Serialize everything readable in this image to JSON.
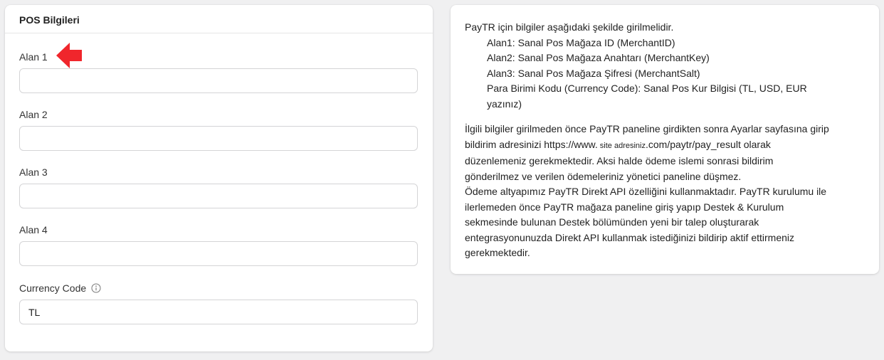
{
  "pos_card": {
    "title": "POS Bilgileri",
    "fields": [
      {
        "label": "Alan 1",
        "value": ""
      },
      {
        "label": "Alan 2",
        "value": ""
      },
      {
        "label": "Alan 3",
        "value": ""
      },
      {
        "label": "Alan 4",
        "value": ""
      },
      {
        "label": "Currency Code",
        "value": "TL"
      }
    ],
    "info_icon": "info-circle-icon",
    "annotation_arrow": "red-arrow-icon",
    "annotation_color": "#f0262c"
  },
  "info_card": {
    "intro": "PayTR için bilgiler aşağıdaki şekilde girilmelidir.",
    "items": [
      "Alan1: Sanal Pos Mağaza ID (MerchantID)",
      "Alan2: Sanal Pos Mağaza Anahtarı (MerchantKey)",
      "Alan3: Sanal Pos Mağaza Şifresi (MerchantSalt)",
      "Para Birimi Kodu (Currency Code): Sanal Pos Kur Bilgisi (TL, USD, EUR",
      "yazınız)"
    ],
    "para1_part1": "İlgili bilgiler girilmeden önce PayTR paneline girdikten sonra Ayarlar sayfasına girip",
    "para1_part2a": "bildirim adresinizi https://www.",
    "para1_part2_small": " site adresiniz",
    "para1_part2b": ".com/paytr/pay_result olarak",
    "para1_part3": "düzenlemeniz gerekmektedir. Aksi halde ödeme islemi sonrasi bildirim",
    "para1_part4": "gönderilmez ve verilen ödemeleriniz yönetici paneline düşmez.",
    "para2_lines": [
      "Ödeme altyapımız PayTR Direkt API özelliğini kullanmaktadır. PayTR kurulumu ile",
      "ilerlemeden önce PayTR mağaza paneline giriş yapıp Destek & Kurulum",
      "sekmesinde bulunan Destek bölümünden yeni bir talep oluşturarak",
      "entegrasyonunuzda Direkt API kullanmak istediğinizi bildirip aktif ettirmeniz",
      "gerekmektedir."
    ]
  }
}
